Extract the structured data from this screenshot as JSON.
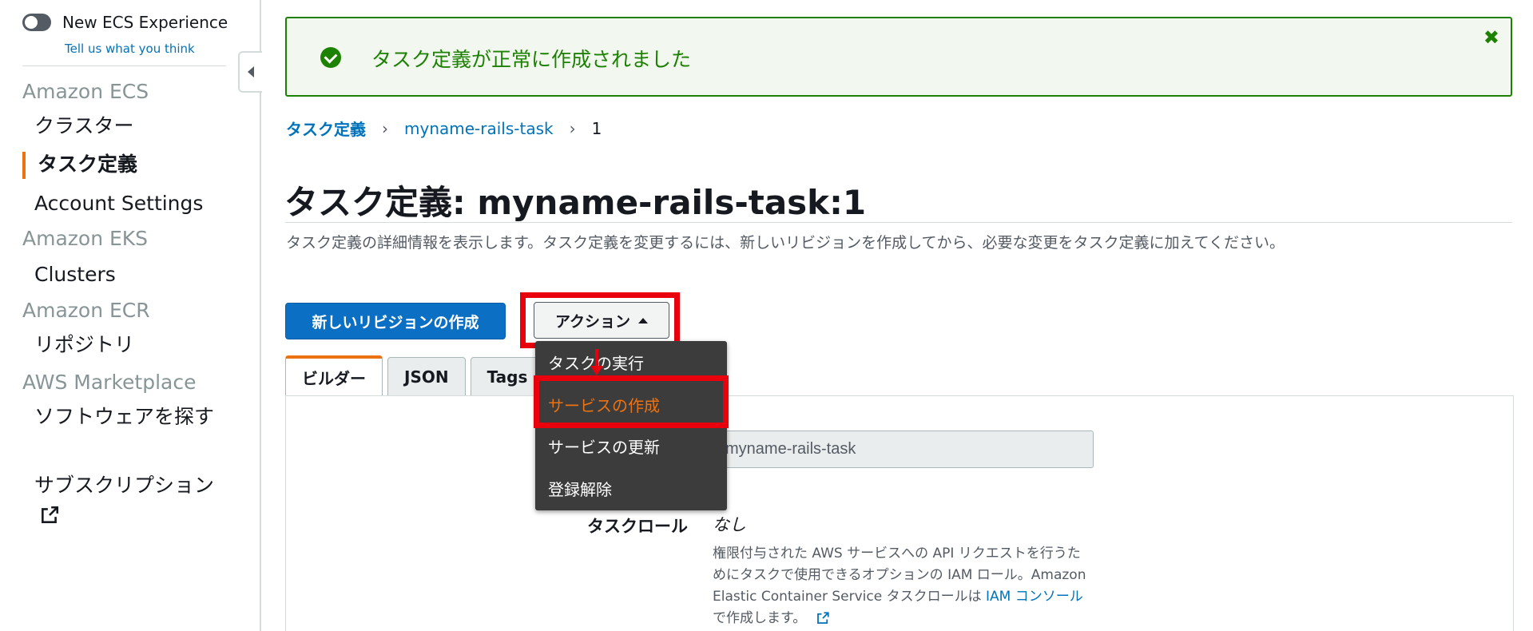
{
  "sidebar": {
    "toggle_label": "New ECS Experience",
    "feedback_link": "Tell us what you think",
    "sections": [
      {
        "title": "Amazon ECS",
        "items": [
          "クラスター",
          "タスク定義",
          "Account Settings"
        ]
      },
      {
        "title": "Amazon EKS",
        "items": [
          "Clusters"
        ]
      },
      {
        "title": "Amazon ECR",
        "items": [
          "リポジトリ"
        ]
      },
      {
        "title": "AWS Marketplace",
        "items": [
          "ソフトウェアを探す",
          "サブスクリプション"
        ]
      }
    ],
    "active_item": "タスク定義",
    "icons": {
      "toggle": "toggle-icon",
      "collapse": "collapse-left-icon",
      "external": "external-link-icon"
    }
  },
  "flash": {
    "message": "タスク定義が正常に作成されました",
    "icon": "check-circle-icon",
    "close_icon": "close-icon",
    "color": "#1d8102"
  },
  "breadcrumb": {
    "items": [
      "タスク定義",
      "myname-rails-task",
      "1"
    ],
    "separator": "›"
  },
  "page": {
    "title": "タスク定義: myname-rails-task:1",
    "description": "タスク定義の詳細情報を表示します。タスク定義を変更するには、新しいリビジョンを作成してから、必要な変更をタスク定義に加えてください。"
  },
  "toolbar": {
    "create_revision_label": "新しいリビジョンの作成",
    "actions_label": "アクション"
  },
  "actions_menu": {
    "items": [
      "タスクの実行",
      "サービスの作成",
      "サービスの更新",
      "登録解除"
    ],
    "selected": "サービスの作成"
  },
  "tabs": [
    "ビルダー",
    "JSON",
    "Tags"
  ],
  "active_tab": "ビルダー",
  "form": {
    "task_name_value": "myname-rails-task",
    "task_role_label": "タスクロール",
    "task_role_value": "なし",
    "task_role_help_1": "権限付与された AWS サービスへの API リクエストを行うためにタスクで使用できるオプションの IAM ロール。Amazon Elastic Container Service タスクロールは ",
    "task_role_help_link": "IAM コンソール",
    "task_role_help_2": "で作成します。"
  },
  "colors": {
    "accent": "#ec7211",
    "primary": "#0b6fc4",
    "link": "#0073bb",
    "highlight": "#e8000d"
  }
}
